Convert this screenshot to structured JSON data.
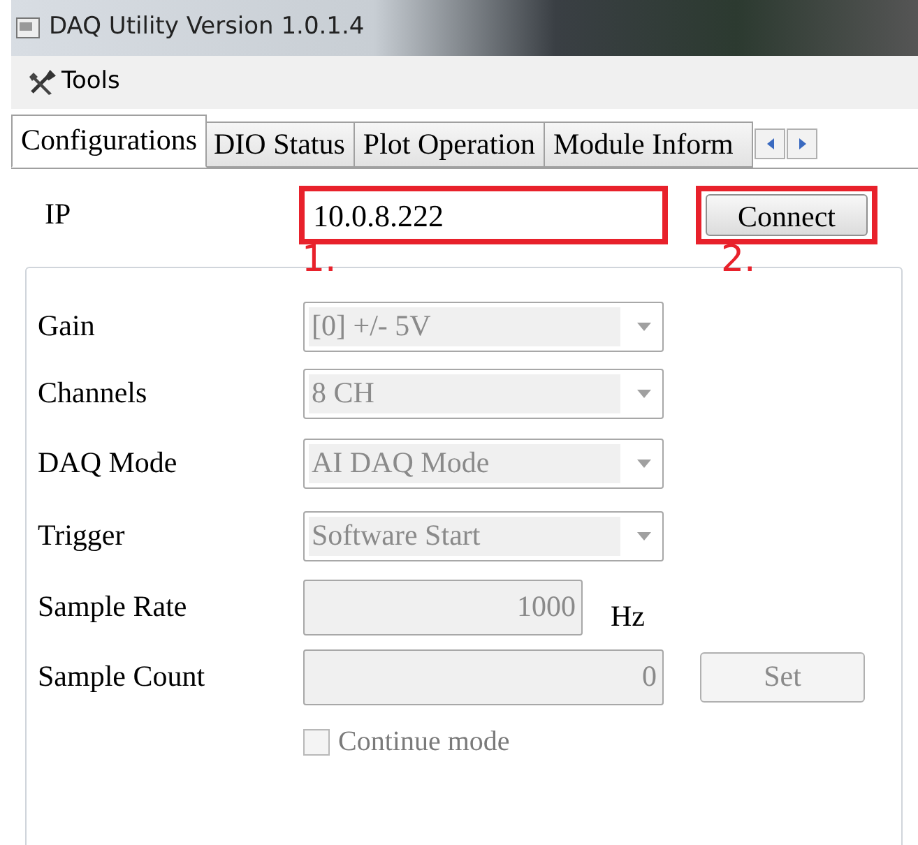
{
  "window": {
    "title": "DAQ Utility Version 1.0.1.4"
  },
  "menu": [
    {
      "label": "Tools"
    }
  ],
  "tabs": [
    {
      "label": "Configurations",
      "selected": true
    },
    {
      "label": "DIO Status",
      "selected": false
    },
    {
      "label": "Plot Operation",
      "selected": false
    },
    {
      "label": "Module Inform",
      "selected": false
    }
  ],
  "ip": {
    "label": "IP",
    "value": "10.0.8.222",
    "annotation": "1."
  },
  "connect": {
    "label": "Connect",
    "annotation": "2."
  },
  "fields": [
    {
      "kind": "dropdown",
      "label": "Gain",
      "value": "[0] +/- 5V",
      "disabled": true
    },
    {
      "kind": "dropdown",
      "label": "Channels",
      "value": "8 CH",
      "disabled": true
    },
    {
      "kind": "dropdown",
      "label": "DAQ Mode",
      "value": "AI DAQ Mode",
      "disabled": true
    },
    {
      "kind": "dropdown",
      "label": "Trigger",
      "value": "Software Start",
      "disabled": true
    },
    {
      "kind": "number",
      "label": "Sample Rate",
      "value": "1000",
      "unit": "Hz",
      "disabled": true
    },
    {
      "kind": "number",
      "label": "Sample Count",
      "value": "0",
      "button": "Set",
      "disabled": true
    }
  ],
  "continue_mode": {
    "label": "Continue mode",
    "checked": false,
    "disabled": true
  }
}
